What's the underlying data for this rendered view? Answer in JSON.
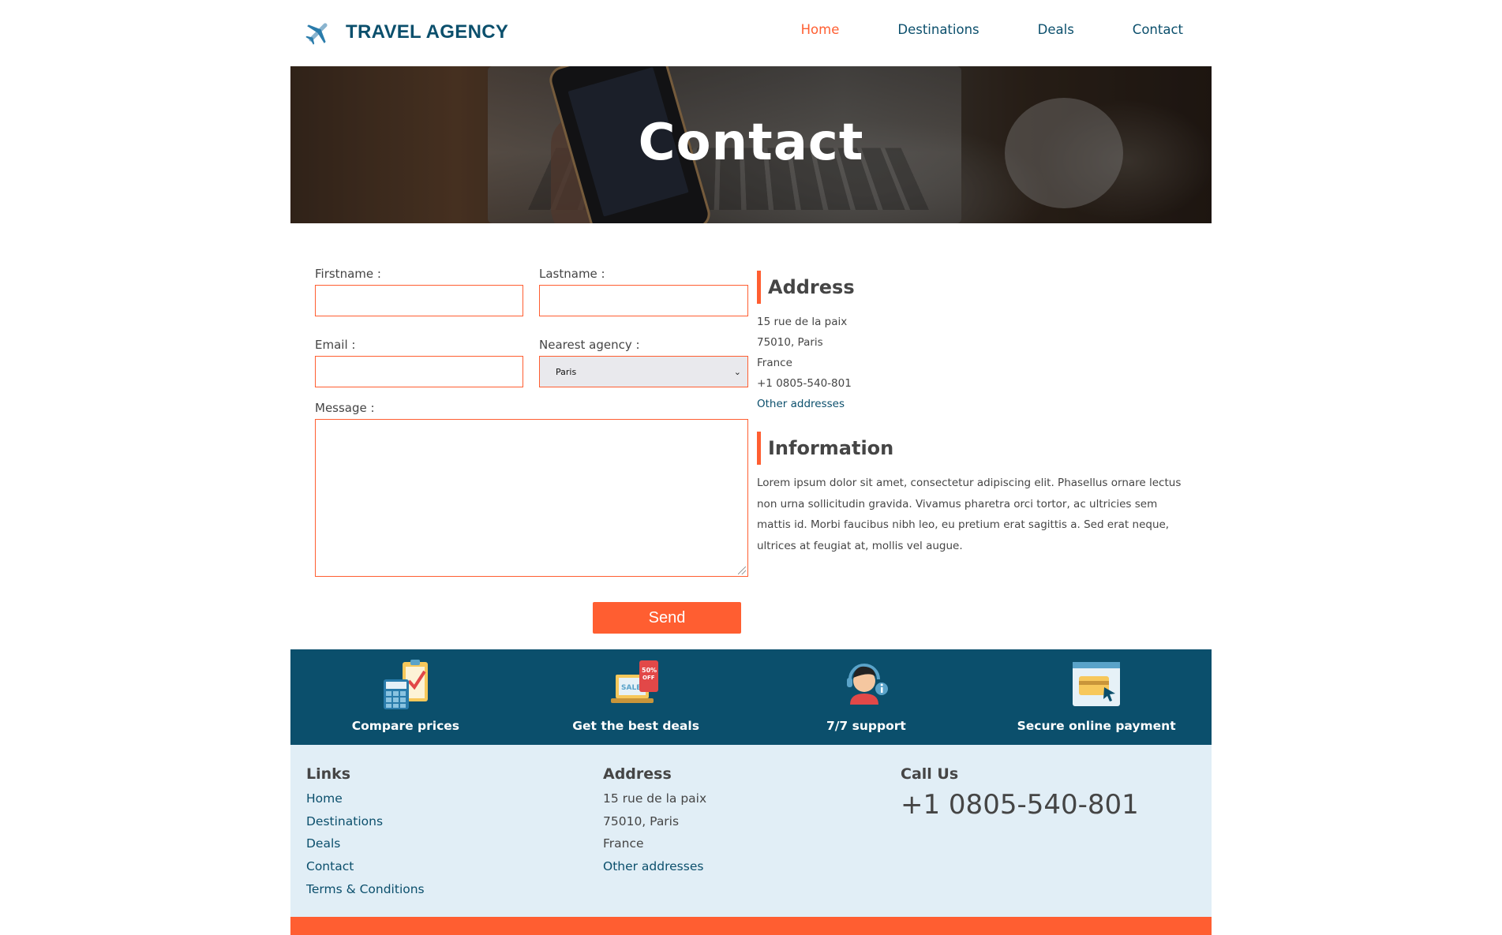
{
  "brand": {
    "name": "TRAVEL AGENCY"
  },
  "nav": [
    {
      "label": "Home",
      "active": true
    },
    {
      "label": "Destinations",
      "active": false
    },
    {
      "label": "Deals",
      "active": false
    },
    {
      "label": "Contact",
      "active": false
    }
  ],
  "hero": {
    "title": "Contact"
  },
  "form": {
    "firstname_label": "Firstname :",
    "lastname_label": "Lastname :",
    "email_label": "Email :",
    "agency_label": "Nearest agency :",
    "agency_value": "Paris",
    "message_label": "Message :",
    "send_label": "Send"
  },
  "address": {
    "heading": "Address",
    "lines": [
      "15 rue de la paix",
      "75010, Paris",
      "France",
      "+1 0805-540-801"
    ],
    "link": "Other addresses"
  },
  "information": {
    "heading": "Information",
    "text": "Lorem ipsum dolor sit amet, consectetur adipiscing elit. Phasellus ornare lectus non urna sollicitudin gravida. Vivamus pharetra orci tortor, ac ultricies sem mattis id. Morbi faucibus nibh leo, eu pretium erat sagittis a. Sed erat neque, ultrices at feugiat at, mollis vel augue."
  },
  "features": [
    {
      "label": "Compare prices",
      "icon": "compare-prices-icon"
    },
    {
      "label": "Get the best deals",
      "icon": "sale-laptop-icon"
    },
    {
      "label": "7/7 support",
      "icon": "support-agent-icon"
    },
    {
      "label": "Secure online payment",
      "icon": "credit-card-payment-icon"
    }
  ],
  "footer": {
    "links_heading": "Links",
    "links": [
      "Home",
      "Destinations",
      "Deals",
      "Contact",
      "Terms & Conditions"
    ],
    "address_heading": "Address",
    "address_lines": [
      "15 rue de la paix",
      "75010, Paris",
      "France"
    ],
    "address_link": "Other addresses",
    "call_heading": "Call Us",
    "phone": "+1 0805-540-801"
  },
  "colors": {
    "accent": "#ff5e31",
    "primary": "#0b4f6c",
    "footer_bg": "#e1eef6",
    "text": "#454545"
  }
}
